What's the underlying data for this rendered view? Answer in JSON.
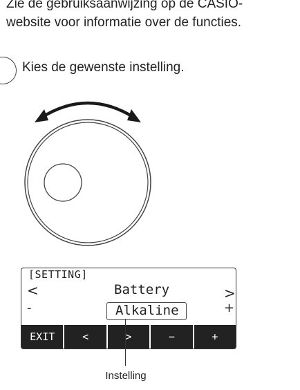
{
  "intro": {
    "line1": "Zie de gebruiksaanwijzing op de CASIO-",
    "line2": "website voor informatie over de functies."
  },
  "step": {
    "instruction": "Kies de gewenste instelling."
  },
  "lcd": {
    "title": "[SETTING]",
    "parameter": "Battery",
    "value": "Alkaline",
    "left_arrow": "<",
    "right_arrow": ">",
    "minus": "-",
    "plus": "+",
    "softkeys": [
      "EXIT",
      "<",
      ">",
      "−",
      "+"
    ]
  },
  "callout": {
    "label": "Instelling"
  },
  "icons": [
    "rotate-arrow-icon",
    "dial-icon"
  ]
}
